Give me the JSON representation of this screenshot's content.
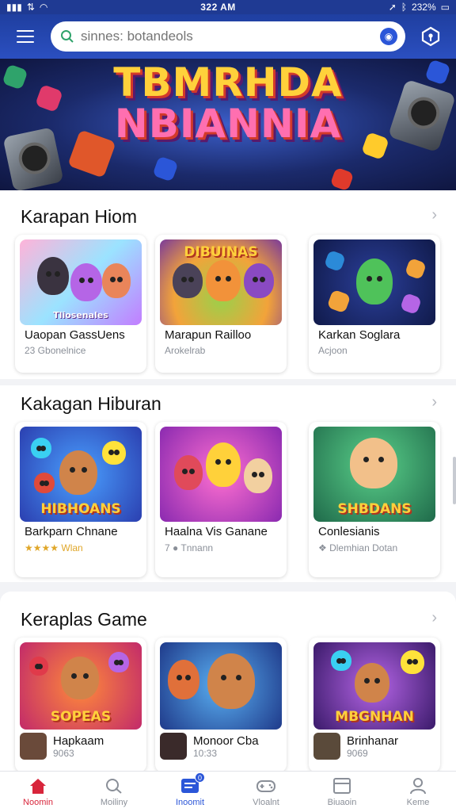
{
  "status_bar": {
    "time": "322 AM",
    "battery": "232%"
  },
  "search": {
    "placeholder": "sinnes: botandeols"
  },
  "banner": {
    "title_line1": "TBMRHDA",
    "title_line2": "NBIANNIA"
  },
  "sections": [
    {
      "title": "Karapan Hiom",
      "cards": [
        {
          "thumb_text": "Tliosenales",
          "name": "Uaopan GassUens",
          "sub": "23 Gbonelnice"
        },
        {
          "thumb_text": "DIBUINAS",
          "name": "Marapun Railloo",
          "sub": "Arokelrab"
        },
        {
          "thumb_text": "",
          "name": "Karkan Soglara",
          "sub": "Acjoon"
        }
      ]
    },
    {
      "title": "Kakagan Hiburan",
      "cards": [
        {
          "thumb_text": "HIBHOANS",
          "name": "Barkparn Chnane",
          "sub": "★★★★ Wlan"
        },
        {
          "thumb_text": "",
          "name": "Haalna Vis Ganane",
          "sub": "7 ● Tnnann"
        },
        {
          "thumb_text": "SHBDANS",
          "name": "Conlesianis",
          "sub": "❖ Dlemhian Dotan"
        }
      ]
    },
    {
      "title": "Keraplas Game",
      "cards": [
        {
          "thumb_text": "SOPEAS",
          "name": "Hapkaam",
          "sub": "9063"
        },
        {
          "thumb_text": "",
          "name": "Monoor Cba",
          "sub": "10:33"
        },
        {
          "thumb_text": "MBGNHAN",
          "name": "Brinhanar",
          "sub": "9069"
        }
      ]
    }
  ],
  "nav": [
    {
      "label": "Noomin"
    },
    {
      "label": "Moiliny"
    },
    {
      "label": "Inoomit",
      "badge": "0"
    },
    {
      "label": "Vloalnt"
    },
    {
      "label": "Biuaoin"
    },
    {
      "label": "Keme"
    }
  ],
  "colors": {
    "primary": "#2b4fc0",
    "active": "#d8253b",
    "accent": "#2b56d8"
  }
}
